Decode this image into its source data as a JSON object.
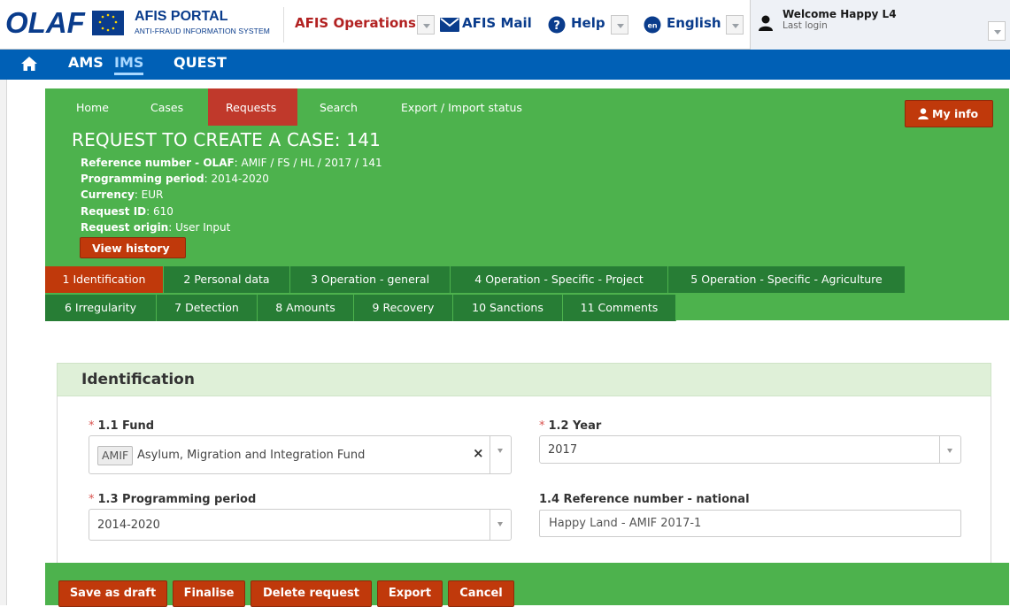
{
  "topbar": {
    "portal_title": "AFIS PORTAL",
    "portal_subtitle": "ANTI-FRAUD INFORMATION SYSTEM",
    "operations": "AFIS Operations",
    "mail": "AFIS Mail",
    "help": "Help",
    "language": "English",
    "lang_badge": "en",
    "welcome": "Welcome Happy L4",
    "last_login": "Last login"
  },
  "bluenav": {
    "items": [
      "AMS",
      "IMS",
      "QUEST"
    ],
    "active": "IMS"
  },
  "greennav": {
    "items": [
      "Home",
      "Cases",
      "Requests",
      "Search",
      "Export / Import status"
    ],
    "active": "Requests",
    "my_info": "My info"
  },
  "request": {
    "title": "REQUEST TO CREATE A CASE: 141",
    "ref_label": "Reference number - OLAF",
    "ref_value": ": AMIF / FS / HL / 2017 / 141",
    "period_label": "Programming period",
    "period_value": ": 2014-2020",
    "currency_label": "Currency",
    "currency_value": ": EUR",
    "request_id_label": "Request ID",
    "request_id_value": ": 610",
    "origin_label": "Request origin",
    "origin_value": ": User Input",
    "view_history": "View history"
  },
  "tabs_row1": [
    "1 Identification",
    "2 Personal data",
    "3 Operation - general",
    "4 Operation - Specific - Project",
    "5 Operation - Specific - Agriculture"
  ],
  "tabs_row2": [
    "6 Irregularity",
    "7 Detection",
    "8 Amounts",
    "9 Recovery",
    "10 Sanctions",
    "11 Comments"
  ],
  "active_tab": "1 Identification",
  "form": {
    "section_title": "Identification",
    "required_mark": "*",
    "fund_label": "1.1 Fund",
    "fund_code": "AMIF",
    "fund_value": "Asylum, Migration and Integration Fund",
    "clear_symbol": "×",
    "year_label": "1.2 Year",
    "year_value": "2017",
    "period_label": "1.3 Programming period",
    "period_value": "2014-2020",
    "refnat_label": "1.4 Reference number - national",
    "refnat_value": "Happy Land - AMIF 2017-1"
  },
  "actions": [
    "Save as draft",
    "Finalise",
    "Delete request",
    "Export",
    "Cancel"
  ],
  "colors": {
    "green": "#4db24d",
    "dark_green_tab": "#277d35",
    "red_button": "#c0390b",
    "blue_nav": "#0060b6"
  }
}
